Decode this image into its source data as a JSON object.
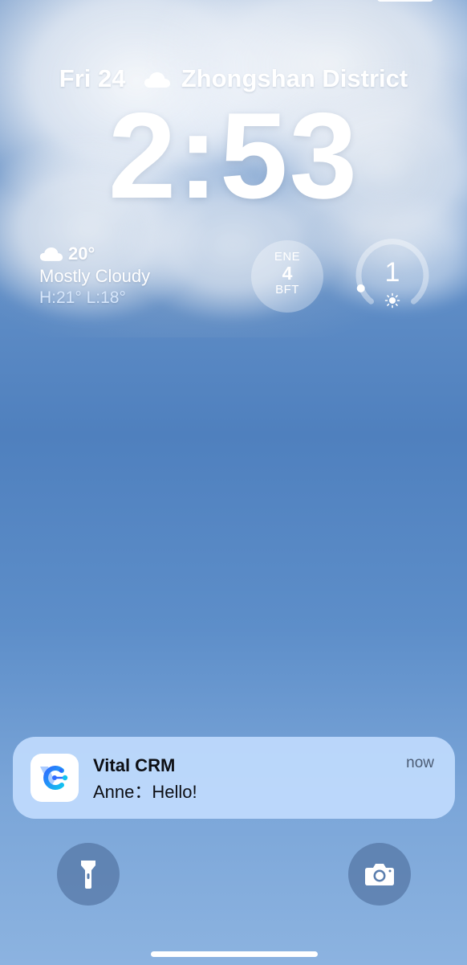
{
  "lock_screen": {
    "date": "Fri 24",
    "location": "Zhongshan District",
    "time": "2:53",
    "location_weather_icon": "cloud-icon"
  },
  "weather_widget": {
    "icon": "cloud-icon",
    "temperature": "20°",
    "condition": "Mostly Cloudy",
    "high_low": "H:21° L:18°"
  },
  "wind_widget": {
    "direction": "ENE",
    "speed": "4",
    "unit": "BFT"
  },
  "uv_widget": {
    "value": "1",
    "icon": "sun-icon",
    "gauge_level": 0.09
  },
  "notification": {
    "app_name": "Vital CRM",
    "message": "Anne：Hello!",
    "time": "now",
    "app_icon": "vital-crm-logo",
    "brand_colors": [
      "#2f6bff",
      "#12c2ef"
    ]
  },
  "quick_actions": {
    "flashlight_icon": "flashlight-icon",
    "camera_icon": "camera-icon"
  }
}
